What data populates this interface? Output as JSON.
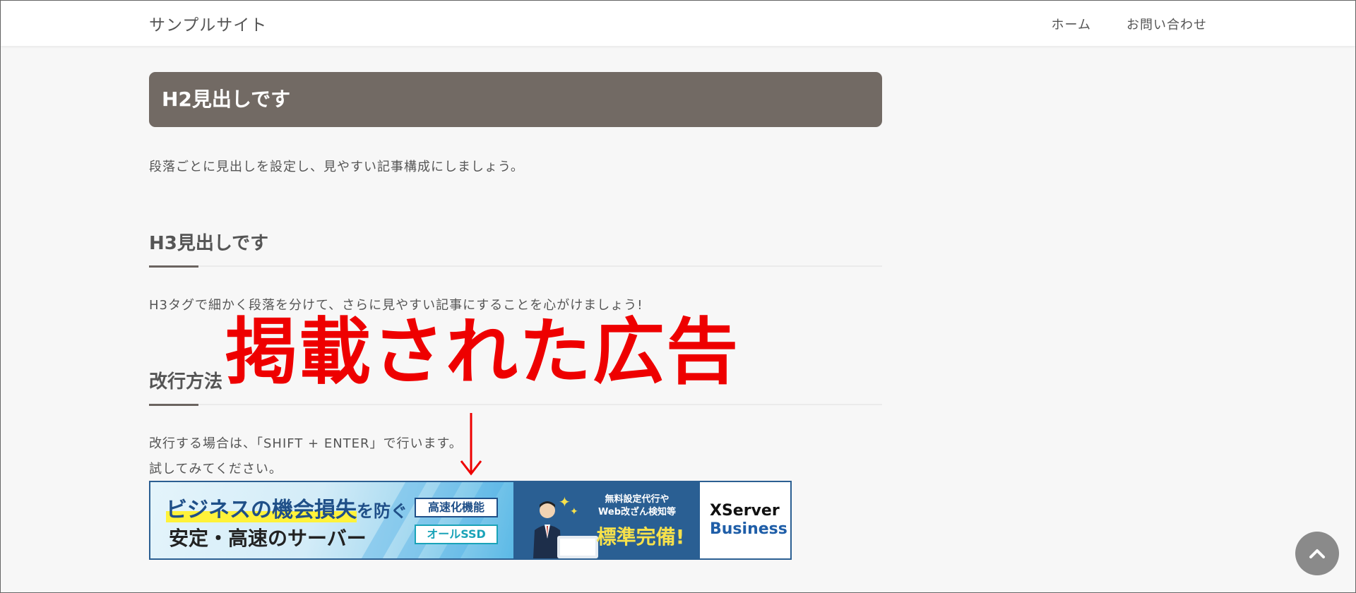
{
  "header": {
    "site_title": "サンプルサイト",
    "nav": [
      "ホーム",
      "お問い合わせ"
    ]
  },
  "article": {
    "h2": "H2見出しです",
    "p1": "段落ごとに見出しを設定し、見やすい記事構成にしましょう。",
    "h3_1": "H3見出しです",
    "p2": "H3タグで細かく段落を分けて、さらに見やすい記事にすることを心がけましょう!",
    "h3_2": "改行方法",
    "p3_line1": "改行する場合は、「SHIFT + ENTER」で行います。",
    "p3_line2": "試してみてください。"
  },
  "annotation": {
    "text": "掲載された広告",
    "color": "#ee0000"
  },
  "banner": {
    "line1_hl": "ビジネスの機会損失",
    "line1_rest": "を防ぐ",
    "line2": "安定・高速のサーバー",
    "tag1": "高速化機能",
    "tag2": "オールSSD",
    "mid_line1": "無料設定代行や",
    "mid_line2": "Web改ざん検知等",
    "mid_big": "標準完備!",
    "brand_line1": "XServer",
    "brand_line2": "Business"
  },
  "colors": {
    "h2_bg": "#726a64",
    "page_bg": "#f7f7f7",
    "banner_navy": "#2a5f93"
  },
  "icons": {
    "back_to_top": "chevron-up-icon",
    "annotation_arrow": "arrow-down-icon"
  }
}
